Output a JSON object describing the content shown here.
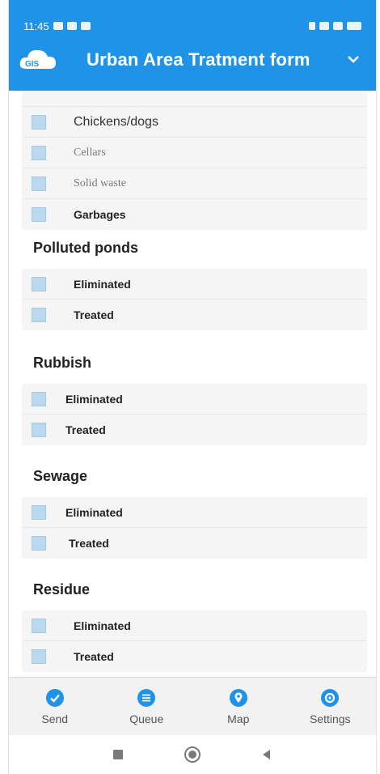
{
  "status_bar": {
    "time": "11:45",
    "battery": ""
  },
  "header": {
    "title": "Urban Area Tratment form",
    "logo_text": "GIS"
  },
  "first_group": {
    "items": [
      {
        "label": "Chickens/dogs"
      },
      {
        "label": "Cellars"
      },
      {
        "label": "Solid waste"
      },
      {
        "label": "Garbages"
      }
    ]
  },
  "sections": [
    {
      "title": "Polluted ponds",
      "options": [
        "Eliminated",
        "Treated"
      ]
    },
    {
      "title": "Rubbish",
      "options": [
        "Eliminated",
        "Treated"
      ]
    },
    {
      "title": "Sewage",
      "options": [
        "Eliminated",
        "Treated"
      ]
    },
    {
      "title": "Residue",
      "options": [
        "Eliminated",
        "Treated"
      ]
    }
  ],
  "bottom_nav": [
    {
      "label": "Send",
      "icon": "check-circle-icon"
    },
    {
      "label": "Queue",
      "icon": "list-circle-icon"
    },
    {
      "label": "Map",
      "icon": "map-pin-icon"
    },
    {
      "label": "Settings",
      "icon": "settings-circle-icon"
    }
  ],
  "colors": {
    "primary": "#1f93e8",
    "checkbox": "#b9d9ef"
  }
}
